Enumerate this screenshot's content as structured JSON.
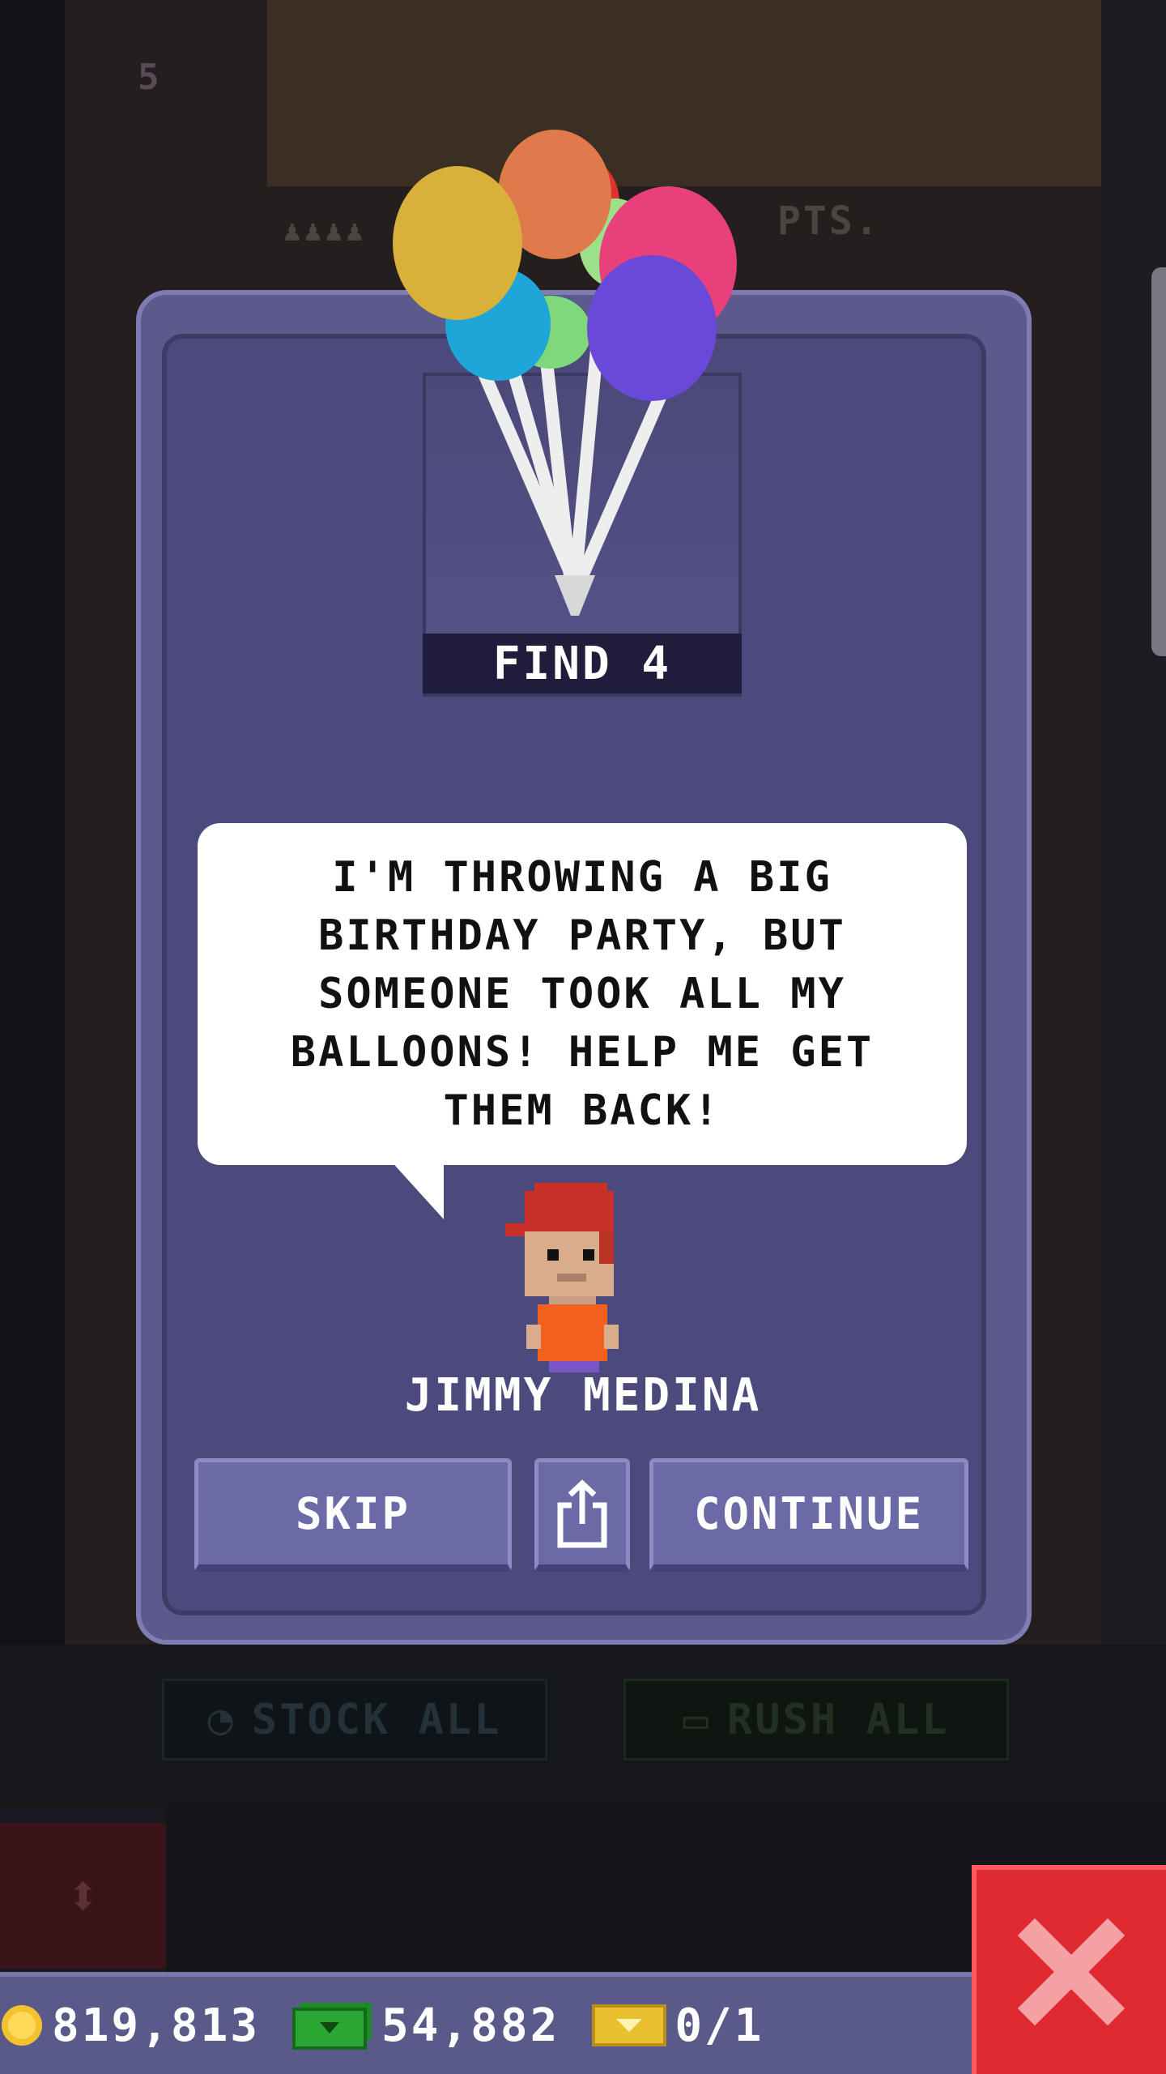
{
  "background": {
    "floor_number": "5",
    "points_text": "PTS.",
    "stock_all_label": "STOCK ALL",
    "rush_all_label": "RUSH ALL"
  },
  "mission": {
    "item_name": "balloons-icon",
    "find_label": "FIND 4",
    "speech": "I'M THROWING A BIG BIRTHDAY PARTY, BUT SOMEONE TOOK ALL MY BALLOONS! HELP ME GET THEM BACK!",
    "character_name": "JIMMY MEDINA"
  },
  "buttons": {
    "skip_label": "SKIP",
    "share_icon": "share-icon",
    "continue_label": "CONTINUE",
    "close_icon": "close-icon"
  },
  "hud": {
    "coins": "819,813",
    "bux": "54,882",
    "vip_tickets": "0/1"
  },
  "colors": {
    "modal": "#5c5a8c",
    "button": "#6b69a6",
    "close": "#e02a32",
    "coin": "#f2c230",
    "bux": "#2aa632",
    "ticket": "#e8c030"
  }
}
